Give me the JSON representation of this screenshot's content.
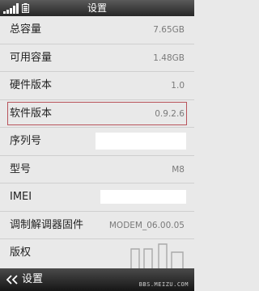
{
  "status_bar": {
    "title": "设置",
    "icons": [
      "signal-icon",
      "battery-icon"
    ]
  },
  "rows": [
    {
      "label": "总容量",
      "value": "7.65GB"
    },
    {
      "label": "可用容量",
      "value": "1.48GB"
    },
    {
      "label": "硬件版本",
      "value": "1.0"
    },
    {
      "label": "软件版本",
      "value": "0.9.2.6"
    },
    {
      "label": "序列号",
      "value": ""
    },
    {
      "label": "型号",
      "value": "M8"
    },
    {
      "label": "IMEI",
      "value": ""
    },
    {
      "label": "调制解调器固件",
      "value": "MODEM_06.00.05"
    },
    {
      "label": "版权",
      "value": ""
    }
  ],
  "bottom_bar": {
    "back_label": "设置",
    "back_icon": "double-chevron-left-icon"
  },
  "watermark": {
    "text": "BBS.MEIZU.COM"
  },
  "colors": {
    "background": "#e9e9e9",
    "highlight_border": "#b8535b",
    "bar_dark": "#262626"
  }
}
